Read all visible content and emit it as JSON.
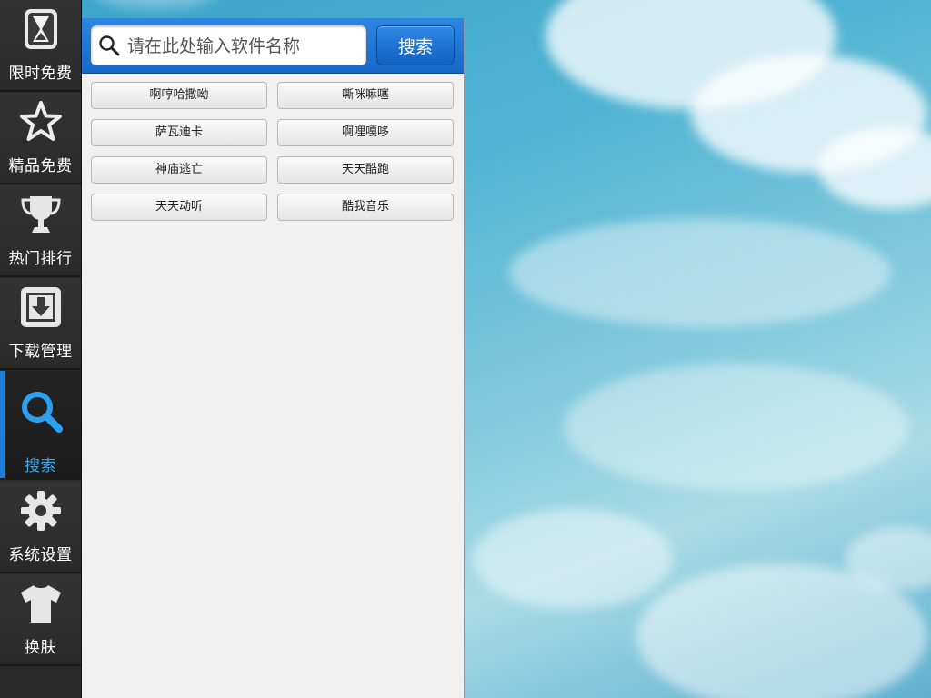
{
  "sidebar": {
    "items": [
      {
        "label": "限时免费",
        "icon": "hourglass-icon"
      },
      {
        "label": "精品免费",
        "icon": "star-icon"
      },
      {
        "label": "热门排行",
        "icon": "trophy-icon"
      },
      {
        "label": "下载管理",
        "icon": "download-icon"
      },
      {
        "label": "搜索",
        "icon": "search-icon",
        "active": true
      },
      {
        "label": "系统设置",
        "icon": "gear-icon"
      },
      {
        "label": "换肤",
        "icon": "tshirt-icon"
      }
    ]
  },
  "search": {
    "placeholder": "请在此处输入软件名称",
    "button_label": "搜索"
  },
  "tags": [
    "啊哼哈撒呦",
    "嘶咪嘛噻",
    "萨瓦迪卡",
    "啊哩嘎哆",
    "神庙逃亡",
    "天天酷跑",
    "天天动听",
    "酷我音乐"
  ],
  "colors": {
    "accent": "#1e7fd6",
    "active_label": "#3aa6ee",
    "sidebar_bg": "#2b2b2b",
    "panel_bg": "#f1f1f1"
  }
}
